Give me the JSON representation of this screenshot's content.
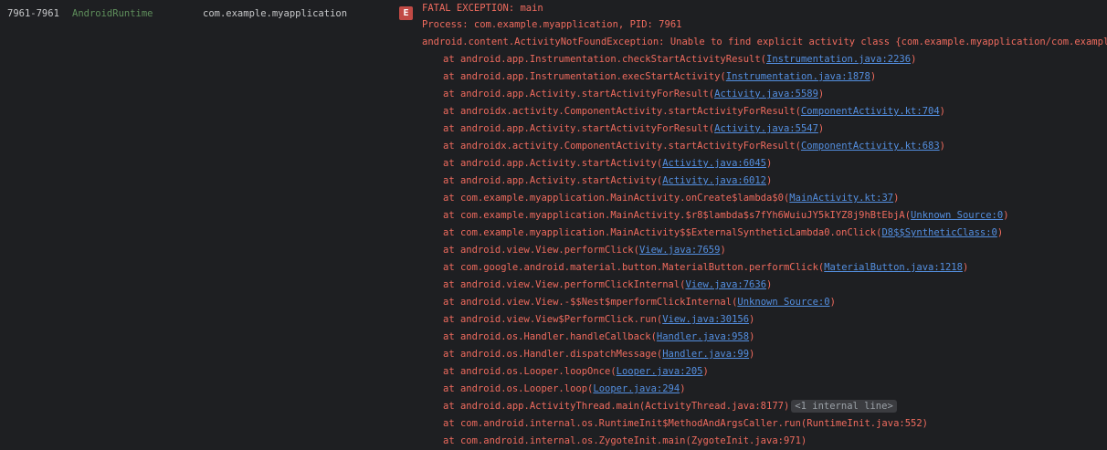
{
  "entry": {
    "pid": "7961-7961",
    "tag": "AndroidRuntime",
    "package": "com.example.myapplication",
    "level": "E"
  },
  "log_lines": [
    {
      "text": "FATAL EXCEPTION: main",
      "link": "",
      "suffix": "",
      "badge": "",
      "indent": false
    },
    {
      "text": "Process: com.example.myapplication, PID: 7961",
      "link": "",
      "suffix": "",
      "badge": "",
      "indent": false
    },
    {
      "text": "android.content.ActivityNotFoundException: Unable to find explicit activity class {com.example.myapplication/com.example.mya",
      "link": "",
      "suffix": "",
      "badge": "",
      "indent": false
    },
    {
      "text": "at android.app.Instrumentation.checkStartActivityResult(",
      "link": "Instrumentation.java:2236",
      "suffix": ")",
      "badge": "",
      "indent": true
    },
    {
      "text": "at android.app.Instrumentation.execStartActivity(",
      "link": "Instrumentation.java:1878",
      "suffix": ")",
      "badge": "",
      "indent": true
    },
    {
      "text": "at android.app.Activity.startActivityForResult(",
      "link": "Activity.java:5589",
      "suffix": ")",
      "badge": "",
      "indent": true
    },
    {
      "text": "at androidx.activity.ComponentActivity.startActivityForResult(",
      "link": "ComponentActivity.kt:704",
      "suffix": ")",
      "badge": "",
      "indent": true
    },
    {
      "text": "at android.app.Activity.startActivityForResult(",
      "link": "Activity.java:5547",
      "suffix": ")",
      "badge": "",
      "indent": true
    },
    {
      "text": "at androidx.activity.ComponentActivity.startActivityForResult(",
      "link": "ComponentActivity.kt:683",
      "suffix": ")",
      "badge": "",
      "indent": true
    },
    {
      "text": "at android.app.Activity.startActivity(",
      "link": "Activity.java:6045",
      "suffix": ")",
      "badge": "",
      "indent": true
    },
    {
      "text": "at android.app.Activity.startActivity(",
      "link": "Activity.java:6012",
      "suffix": ")",
      "badge": "",
      "indent": true
    },
    {
      "text": "at com.example.myapplication.MainActivity.onCreate$lambda$0(",
      "link": "MainActivity.kt:37",
      "suffix": ")",
      "badge": "",
      "indent": true
    },
    {
      "text": "at com.example.myapplication.MainActivity.$r8$lambda$s7fYh6WuiuJY5kIYZ8j9hBtEbjA(",
      "link": "Unknown Source:0",
      "suffix": ")",
      "badge": "",
      "indent": true
    },
    {
      "text": "at com.example.myapplication.MainActivity$$ExternalSyntheticLambda0.onClick(",
      "link": "D8$$SyntheticClass:0",
      "suffix": ")",
      "badge": "",
      "indent": true
    },
    {
      "text": "at android.view.View.performClick(",
      "link": "View.java:7659",
      "suffix": ")",
      "badge": "",
      "indent": true
    },
    {
      "text": "at com.google.android.material.button.MaterialButton.performClick(",
      "link": "MaterialButton.java:1218",
      "suffix": ")",
      "badge": "",
      "indent": true
    },
    {
      "text": "at android.view.View.performClickInternal(",
      "link": "View.java:7636",
      "suffix": ")",
      "badge": "",
      "indent": true
    },
    {
      "text": "at android.view.View.-$$Nest$mperformClickInternal(",
      "link": "Unknown Source:0",
      "suffix": ")",
      "badge": "",
      "indent": true
    },
    {
      "text": "at android.view.View$PerformClick.run(",
      "link": "View.java:30156",
      "suffix": ")",
      "badge": "",
      "indent": true
    },
    {
      "text": "at android.os.Handler.handleCallback(",
      "link": "Handler.java:958",
      "suffix": ")",
      "badge": "",
      "indent": true
    },
    {
      "text": "at android.os.Handler.dispatchMessage(",
      "link": "Handler.java:99",
      "suffix": ")",
      "badge": "",
      "indent": true
    },
    {
      "text": "at android.os.Looper.loopOnce(",
      "link": "Looper.java:205",
      "suffix": ")",
      "badge": "",
      "indent": true
    },
    {
      "text": "at android.os.Looper.loop(",
      "link": "Looper.java:294",
      "suffix": ")",
      "badge": "",
      "indent": true
    },
    {
      "text": "at android.app.ActivityThread.main(ActivityThread.java:8177)",
      "link": "",
      "suffix": "",
      "badge": "<1 internal line>",
      "indent": true
    },
    {
      "text": "at com.android.internal.os.RuntimeInit$MethodAndArgsCaller.run(RuntimeInit.java:552)",
      "link": "",
      "suffix": "",
      "badge": "",
      "indent": true
    },
    {
      "text": "at com.android.internal.os.ZygoteInit.main(ZygoteInit.java:971)",
      "link": "",
      "suffix": "",
      "badge": "",
      "indent": true
    }
  ]
}
